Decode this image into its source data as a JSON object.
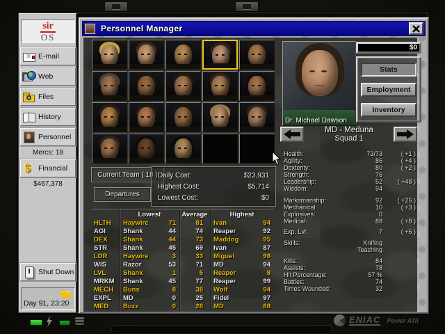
{
  "window": {
    "title": "Personnel Manager"
  },
  "sidebar": {
    "logo_top": "sir",
    "logo_bottom": "OS",
    "items": [
      {
        "id": "email",
        "label": "E-mail",
        "icon": "email-icon"
      },
      {
        "id": "web",
        "label": "Web",
        "icon": "web-icon"
      },
      {
        "id": "files",
        "label": "Files",
        "icon": "files-icon"
      },
      {
        "id": "history",
        "label": "History",
        "icon": "history-icon"
      },
      {
        "id": "personnel",
        "label": "Personnel",
        "icon": "personnel-icon",
        "sub": "Mercs: 18"
      },
      {
        "id": "financial",
        "label": "Financial",
        "icon": "financial-icon",
        "sub": "$467,378"
      }
    ],
    "shutdown_label": "Shut Down",
    "clock": "Day 91, 23:20"
  },
  "portraits": {
    "rows": 4,
    "cols": 5,
    "filled": 18,
    "selected_index": 3,
    "tones": [
      {
        "skin": "#d4a878",
        "hair": "#c8a040"
      },
      {
        "skin": "#d0a074",
        "hair": "#3a2a1a"
      },
      {
        "skin": "#c09058",
        "hair": "#141210"
      },
      {
        "skin": "#c89878",
        "hair": "#2e2217"
      },
      {
        "skin": "#b08058",
        "hair": "#181410"
      },
      {
        "skin": "#a87c54",
        "hair": "#4a4438"
      },
      {
        "skin": "#9a6c44",
        "hair": "#1a140e"
      },
      {
        "skin": "#b08058",
        "hair": "#241a12"
      },
      {
        "skin": "#b8885c",
        "hair": "#30241a"
      },
      {
        "skin": "#a87850",
        "hair": "#100c0a"
      },
      {
        "skin": "#c08850",
        "hair": "#2a1e14"
      },
      {
        "skin": "#b87c54",
        "hair": "#241a10"
      },
      {
        "skin": "#a0744c",
        "hair": "#1c1610"
      },
      {
        "skin": "#c89c74",
        "hair": "#9a7a4a"
      },
      {
        "skin": "#b48866",
        "hair": "#302418"
      },
      {
        "skin": "#a87a52",
        "hair": "#2c2418"
      },
      {
        "skin": "#6a4a32",
        "hair": "#0e0a08"
      },
      {
        "skin": "#b8905c",
        "hair": "#0c0a08"
      }
    ]
  },
  "team_panel": {
    "current_team_label": "Current Team ( 18 )",
    "departures_label": "Departures",
    "costs": [
      {
        "label": "Daily Cost:",
        "value": "$23,931"
      },
      {
        "label": "Highest Cost:",
        "value": "$5,714"
      },
      {
        "label": "Lowest Cost:",
        "value": "$0"
      }
    ]
  },
  "selected_merc": {
    "name": "Dr. Michael Dawson",
    "account_balance": "$0",
    "action_buttons": [
      {
        "label": "Stats",
        "pressed": true
      },
      {
        "label": "Employment",
        "pressed": false
      },
      {
        "label": "Inventory",
        "pressed": false
      }
    ],
    "location_line1": "MD - Meduna",
    "location_line2": "Squad 1",
    "attribute_groups": [
      {
        "rows": [
          {
            "label": "Health:",
            "value": "73/73",
            "bonus": "( +1 )"
          },
          {
            "label": "Agility:",
            "value": "86",
            "bonus": "( +4 )"
          },
          {
            "label": "Dexterity:",
            "value": "80",
            "bonus": "( +2 )"
          },
          {
            "label": "Strength:",
            "value": "76",
            "bonus": ""
          },
          {
            "label": "Leadership:",
            "value": "52",
            "bonus": "( +48 )"
          },
          {
            "label": "Wisdom:",
            "value": "94",
            "bonus": ""
          }
        ]
      },
      {
        "rows": [
          {
            "label": "Marksmanship:",
            "value": "92",
            "bonus": "( +26 )"
          },
          {
            "label": "Mechanical:",
            "value": "10",
            "bonus": "( +3 )"
          },
          {
            "label": "Explosives:",
            "value": "0",
            "bonus": ""
          },
          {
            "label": "Medical:",
            "value": "88",
            "bonus": "( +8 )"
          }
        ]
      },
      {
        "rows": [
          {
            "label": "Exp. Lvl:",
            "value": "7",
            "bonus": "( +6 )"
          }
        ]
      },
      {
        "rows": [
          {
            "label": "Skills:",
            "value": "Knifing",
            "bonus": ""
          },
          {
            "label": "",
            "value": "Teaching",
            "bonus": ""
          }
        ]
      },
      {
        "rows": [
          {
            "label": "Kills:",
            "value": "84",
            "bonus": ""
          },
          {
            "label": "Assists:",
            "value": "78",
            "bonus": ""
          },
          {
            "label": "Hit Percentage:",
            "value": "57 %",
            "bonus": ""
          },
          {
            "label": "Battles:",
            "value": "74",
            "bonus": ""
          },
          {
            "label": "Times Wounded:",
            "value": "32",
            "bonus": ""
          }
        ]
      }
    ]
  },
  "stats_table": {
    "headers": [
      "Lowest",
      "Average",
      "Highest"
    ],
    "rows": [
      {
        "stat": "HLTH",
        "lowest_name": "Haywire",
        "lowest_value": "71",
        "average": "81",
        "highest_name": "Ivan",
        "highest_value": "94"
      },
      {
        "stat": "AGI",
        "lowest_name": "Shank",
        "lowest_value": "44",
        "average": "74",
        "highest_name": "Reaper",
        "highest_value": "92"
      },
      {
        "stat": "DEX",
        "lowest_name": "Shank",
        "lowest_value": "44",
        "average": "73",
        "highest_name": "Maddog",
        "highest_value": "95"
      },
      {
        "stat": "STR",
        "lowest_name": "Shank",
        "lowest_value": "45",
        "average": "69",
        "highest_name": "Ivan",
        "highest_value": "87"
      },
      {
        "stat": "LDR",
        "lowest_name": "Haywire",
        "lowest_value": "3",
        "average": "33",
        "highest_name": "Miguel",
        "highest_value": "98"
      },
      {
        "stat": "WIS",
        "lowest_name": "Razor",
        "lowest_value": "53",
        "average": "71",
        "highest_name": "MD",
        "highest_value": "94"
      },
      {
        "stat": "LVL",
        "lowest_name": "Shank",
        "lowest_value": "1",
        "average": "5",
        "highest_name": "Reaper",
        "highest_value": "8"
      },
      {
        "stat": "MRKM",
        "lowest_name": "Shank",
        "lowest_value": "45",
        "average": "77",
        "highest_name": "Reaper",
        "highest_value": "99"
      },
      {
        "stat": "MECH",
        "lowest_name": "Buns",
        "lowest_value": "8",
        "average": "38",
        "highest_name": "Wolf",
        "highest_value": "94"
      },
      {
        "stat": "EXPL",
        "lowest_name": "MD",
        "lowest_value": "0",
        "average": "25",
        "highest_name": "Fidel",
        "highest_value": "97"
      },
      {
        "stat": "MED",
        "lowest_name": "Buzz",
        "lowest_value": "0",
        "average": "28",
        "highest_name": "MD",
        "highest_value": "88"
      }
    ]
  },
  "bezel": {
    "brand": "ENIAC",
    "brand_sub": "Power ATii"
  },
  "colors": {
    "accent_yellow": "#e2b607",
    "title_bar_blue": "#0a0a96",
    "led_green": "#2fd32f",
    "selection_yellow": "#f0c808"
  }
}
